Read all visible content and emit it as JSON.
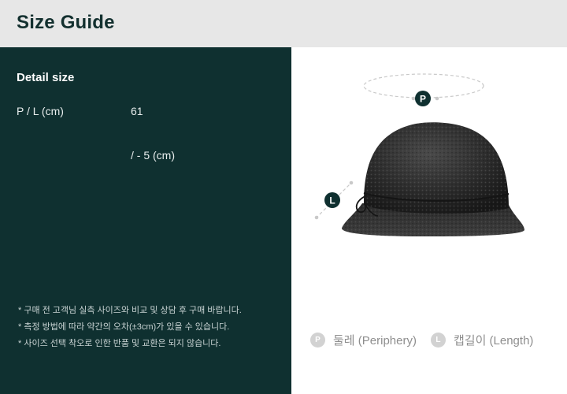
{
  "header": {
    "title": "Size Guide"
  },
  "detail": {
    "title": "Detail size",
    "row_label": "P / L (cm)",
    "value_p": "61",
    "value_l": "/ - 5 (cm)"
  },
  "notes": [
    "* 구매 전 고객님 실측 사이즈와 비교 및 상담 후 구매 바랍니다.",
    "* 측정 방법에 따라 약간의 오차(±3cm)가 있을 수 있습니다.",
    "* 사이즈 선택 착오로 인한 반품 및 교환은 되지 않습니다."
  ],
  "figure": {
    "badge_p": "P",
    "badge_l": "L",
    "hat_icon": "bucket-hat-image",
    "accent_color": "#0f3030"
  },
  "legend": [
    {
      "badge": "P",
      "label": "둘레 (Periphery)"
    },
    {
      "badge": "L",
      "label": "캡길이 (Length)"
    }
  ]
}
